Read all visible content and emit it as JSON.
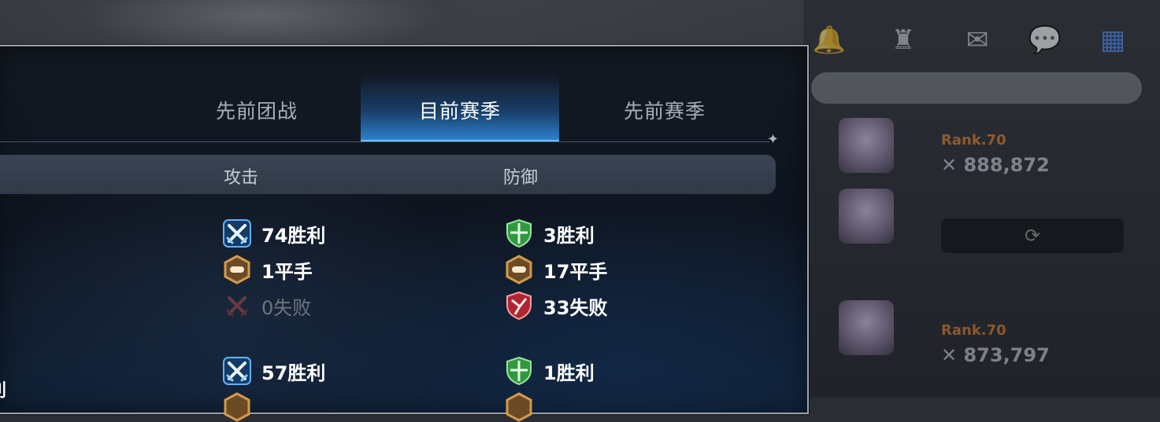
{
  "background": {
    "top_icons": [
      {
        "name": "bell-icon",
        "badge": ""
      },
      {
        "name": "guild-icon",
        "badge": ""
      },
      {
        "name": "mail-icon",
        "badge": ""
      },
      {
        "name": "chat-icon",
        "badge": ""
      },
      {
        "name": "menu-grid-icon",
        "badge": ""
      }
    ],
    "ticker": "",
    "rankings": [
      {
        "name": "",
        "level": "Rank.70",
        "power": "✕ 888,872",
        "time": ""
      },
      {
        "name": "",
        "level": "Rank.70",
        "power": "✕ 873,797",
        "time": ""
      }
    ]
  },
  "tabs": [
    {
      "label": "先前团战",
      "active": false
    },
    {
      "label": "目前赛季",
      "active": true
    },
    {
      "label": "先前赛季",
      "active": false
    }
  ],
  "columns": {
    "attack": "攻击",
    "defense": "防御"
  },
  "records": [
    {
      "attack": [
        {
          "icon": "attack-win-icon",
          "text": "74胜利"
        },
        {
          "icon": "draw-icon",
          "text": "1平手"
        },
        {
          "icon": "attack-loss-icon",
          "text": "0失败"
        }
      ],
      "defense": [
        {
          "icon": "defense-win-icon",
          "text": "3胜利"
        },
        {
          "icon": "draw-icon",
          "text": "17平手"
        },
        {
          "icon": "defense-loss-icon",
          "text": "33失败"
        }
      ]
    },
    {
      "attack": [
        {
          "icon": "attack-win-icon",
          "text": "57胜利"
        }
      ],
      "defense": [
        {
          "icon": "defense-win-icon",
          "text": "1胜利"
        }
      ]
    }
  ],
  "left_edge_text": "利",
  "colors": {
    "active_tab": "#2f86d6",
    "win_green": "#3bb54a",
    "loss_red": "#c8323a",
    "draw_gold": "#d49a4a",
    "attack_blue": "#4aa6ff"
  }
}
